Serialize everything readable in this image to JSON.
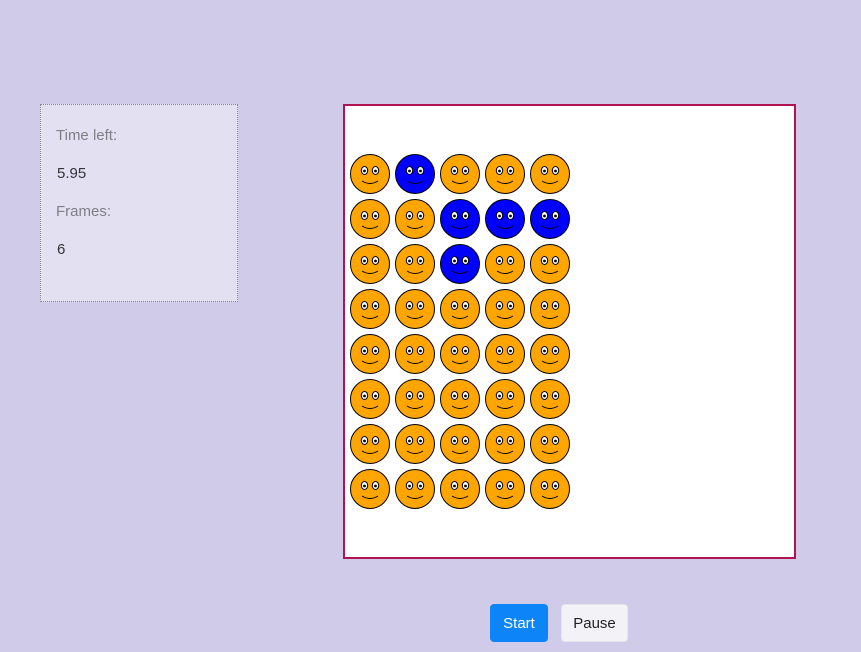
{
  "stats": {
    "time_label": "Time left:",
    "time_value": "5.95",
    "frames_label": "Frames:",
    "frames_value": "6"
  },
  "buttons": {
    "start_label": "Start",
    "pause_label": "Pause"
  },
  "game": {
    "grid": [
      [
        "orange",
        "blue",
        "orange",
        "orange",
        "orange"
      ],
      [
        "orange",
        "orange",
        "blue",
        "blue",
        "blue"
      ],
      [
        "orange",
        "orange",
        "blue",
        "orange",
        "orange"
      ],
      [
        "orange",
        "orange",
        "orange",
        "orange",
        "orange"
      ],
      [
        "orange",
        "orange",
        "orange",
        "orange",
        "orange"
      ],
      [
        "orange",
        "orange",
        "orange",
        "orange",
        "orange"
      ],
      [
        "orange",
        "orange",
        "orange",
        "orange",
        "orange"
      ],
      [
        "orange",
        "orange",
        "orange",
        "orange",
        "orange"
      ]
    ],
    "colors": {
      "orange": "#ffa500",
      "blue": "#0000ff",
      "accent": "#0d84f7",
      "border": "#b0134f"
    }
  }
}
